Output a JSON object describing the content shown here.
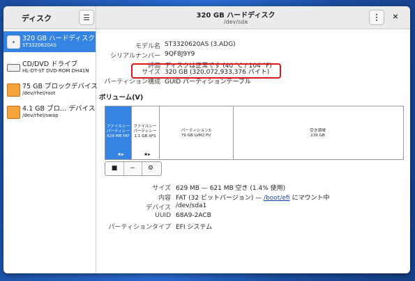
{
  "app": {
    "title": "ディスク"
  },
  "header": {
    "disk_title": "320 GB ハードディスク",
    "disk_path": "/dev/sda",
    "close_label": "×"
  },
  "sidebar": {
    "items": [
      {
        "name": "320 GB ハードディスク",
        "sub": "ST3320620AS",
        "icon": "hard-disk-icon"
      },
      {
        "name": "CD/DVD ドライブ",
        "sub": "HL-DT-ST DVD-ROM DH41N",
        "icon": "optical-drive-icon"
      },
      {
        "name": "75 GB ブロックデバイス",
        "sub": "/dev/rhel/root",
        "icon": "block-device-icon"
      },
      {
        "name": "4.1 GB ブロ… デバイス",
        "sub": "/dev/rhel/swap",
        "icon": "block-device-icon"
      }
    ]
  },
  "info": {
    "model_label": "モデル名",
    "model_value": "ST3320620AS (3.ADG)",
    "serial_label": "シリアルナンバー",
    "serial_value": "9QF8J9Y9",
    "assess_label": "評価",
    "assess_value": "ディスクは正常です (40 °C / 104 °F)",
    "size_label": "サイズ",
    "size_value": "320 GB (320,072,933,376 バイト)",
    "partition_label": "パーティション構成",
    "partition_value": "GUID パーティションテーブル"
  },
  "volumes": {
    "title": "ボリューム(V)",
    "segments": [
      {
        "line1": "ファイルシー",
        "line2": "パーティシー",
        "line3": "629 MB FAT"
      },
      {
        "line1": "ファイルシー",
        "line2": "パーティシー",
        "line3": "1.1 GB XFS"
      },
      {
        "line1": "パーティション3",
        "line2": "79 GB LVM2 PV"
      },
      {
        "line1": "空き領域",
        "line2": "239 GB"
      }
    ],
    "stop_label": "■",
    "minus_label": "−",
    "gear_label": "⚙"
  },
  "selected": {
    "size_label": "サイズ",
    "size_value": "629 MB — 621 MB 空き (1.4% 使用)",
    "content_label": "内容",
    "content_prefix": "FAT (32 ビットバージョン) — ",
    "content_link": "/boot/efi",
    "content_suffix": " にマウント中",
    "device_label": "デバイス",
    "device_value": "/dev/sda1",
    "uuid_label": "UUID",
    "uuid_value": "68A9-2ACB",
    "ptype_label": "パーティションタイプ",
    "ptype_value": "EFI システム"
  },
  "colors": {
    "accent": "#3584e4",
    "highlight_box": "#e0151b",
    "desktop": "#1d54a8"
  }
}
